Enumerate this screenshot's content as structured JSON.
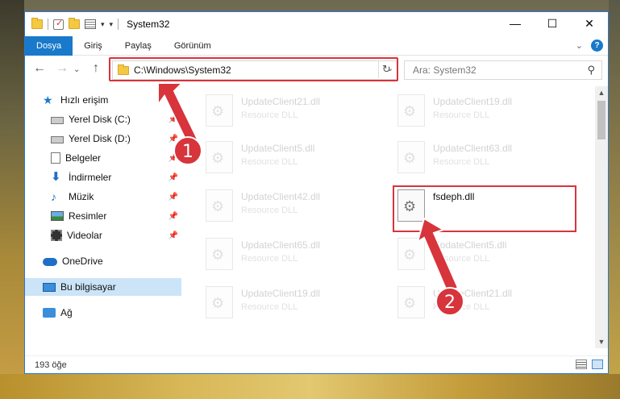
{
  "window": {
    "title": "System32",
    "buttons": {
      "minimize": "—",
      "maximize": "☐",
      "close": "✕"
    }
  },
  "ribbon": {
    "tabs": [
      "Dosya",
      "Giriş",
      "Paylaş",
      "Görünüm"
    ],
    "help": "?"
  },
  "address": {
    "path": "C:\\Windows\\System32",
    "refresh": "↻",
    "dropdown": "⌄"
  },
  "search": {
    "placeholder": "Ara: System32",
    "icon": "⚲"
  },
  "nav": {
    "back": "←",
    "forward": "→",
    "recent": "⌄",
    "up": "↑"
  },
  "sidebar": {
    "items": [
      {
        "label": "Hızlı erişim",
        "icon": "star-icon",
        "pinned": false
      },
      {
        "label": "Yerel Disk (C:)",
        "icon": "drive-icon",
        "pinned": true
      },
      {
        "label": "Yerel Disk (D:)",
        "icon": "drive-icon",
        "pinned": true
      },
      {
        "label": "Belgeler",
        "icon": "documents-icon",
        "pinned": true
      },
      {
        "label": "İndirmeler",
        "icon": "download-icon",
        "pinned": true
      },
      {
        "label": "Müzik",
        "icon": "music-icon",
        "pinned": true
      },
      {
        "label": "Resimler",
        "icon": "pictures-icon",
        "pinned": true
      },
      {
        "label": "Videolar",
        "icon": "videos-icon",
        "pinned": true
      },
      {
        "label": "OneDrive",
        "icon": "onedrive-icon",
        "pinned": false
      },
      {
        "label": "Bu bilgisayar",
        "icon": "computer-icon",
        "pinned": false,
        "selected": true
      },
      {
        "label": "Ağ",
        "icon": "network-icon",
        "pinned": false
      }
    ],
    "pin_glyph": "📌"
  },
  "files": [
    {
      "name": "UpdateClient21.dll",
      "type": "Resource DLL",
      "faded": true
    },
    {
      "name": "UpdateClient19.dll",
      "type": "Resource DLL",
      "faded": true
    },
    {
      "name": "UpdateClient5.dll",
      "type": "Resource DLL",
      "faded": true
    },
    {
      "name": "UpdateClient63.dll",
      "type": "Resource DLL",
      "faded": true
    },
    {
      "name": "UpdateClient42.dll",
      "type": "Resource DLL",
      "faded": true
    },
    {
      "name": "fsdeph.dll",
      "type": "",
      "faded": false
    },
    {
      "name": "UpdateClient65.dll",
      "type": "Resource DLL",
      "faded": true
    },
    {
      "name": "UpdateClient5.dll",
      "type": "Resource DLL",
      "faded": true
    },
    {
      "name": "UpdateClient19.dll",
      "type": "Resource DLL",
      "faded": true
    },
    {
      "name": "UpdateClient21.dll",
      "type": "Resource DLL",
      "faded": true
    }
  ],
  "status": {
    "item_count": "193 öğe"
  },
  "annotations": {
    "badge1": "1",
    "badge2": "2",
    "color": "#d7343b"
  }
}
